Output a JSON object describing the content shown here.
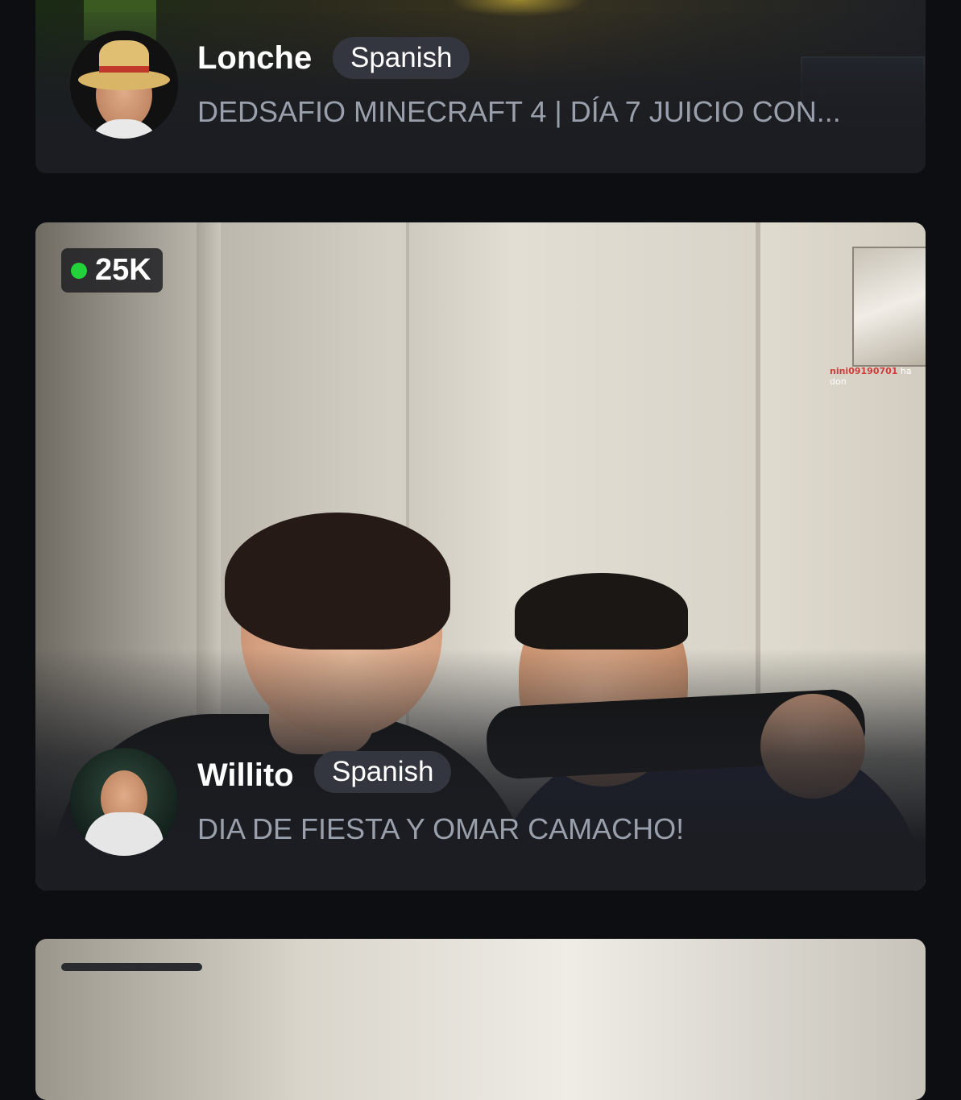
{
  "streams": [
    {
      "name": "Lonche",
      "language": "Spanish",
      "title": "DEDSAFIO MINECRAFT 4 | DÍA 7 JUICIO CON...",
      "avatar_icon": "straw-hat-avatar"
    },
    {
      "viewers": "25K",
      "name": "Willito",
      "language": "Spanish",
      "title": "DIA DE FIESTA Y OMAR CAMACHO!",
      "avatar_icon": "streamer-avatar",
      "overlay_chat": {
        "user": "nini09190701",
        "text": " ha don"
      }
    }
  ],
  "colors": {
    "background": "#0d0e11",
    "card": "#1b1d22",
    "chip": "#33363e",
    "subtitle": "#9aa0ab",
    "live": "#23d13a"
  }
}
